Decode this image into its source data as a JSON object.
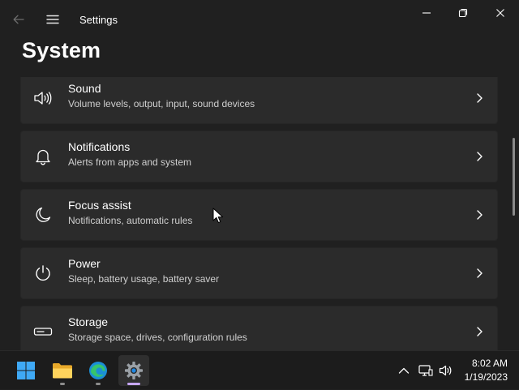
{
  "window": {
    "app_title": "Settings"
  },
  "page": {
    "title": "System"
  },
  "settings_items": [
    {
      "icon": "speaker-icon",
      "title": "Sound",
      "subtitle": "Volume levels, output, input, sound devices"
    },
    {
      "icon": "bell-icon",
      "title": "Notifications",
      "subtitle": "Alerts from apps and system"
    },
    {
      "icon": "moon-icon",
      "title": "Focus assist",
      "subtitle": "Notifications, automatic rules"
    },
    {
      "icon": "power-icon",
      "title": "Power",
      "subtitle": "Sleep, battery usage, battery saver"
    },
    {
      "icon": "storage-icon",
      "title": "Storage",
      "subtitle": "Storage space, drives, configuration rules"
    }
  ],
  "taskbar": {
    "apps": [
      "windows-start-icon",
      "file-explorer-icon",
      "edge-icon",
      "settings-gear-icon"
    ],
    "tray_icons": [
      "chevron-up-icon",
      "network-icon",
      "volume-icon"
    ],
    "time": "8:02 AM",
    "date": "1/19/2023"
  },
  "colors": {
    "background": "#202020",
    "card": "#2b2b2b",
    "taskbar": "#1c1c1c",
    "accent_pip": "#c7a7ff"
  }
}
